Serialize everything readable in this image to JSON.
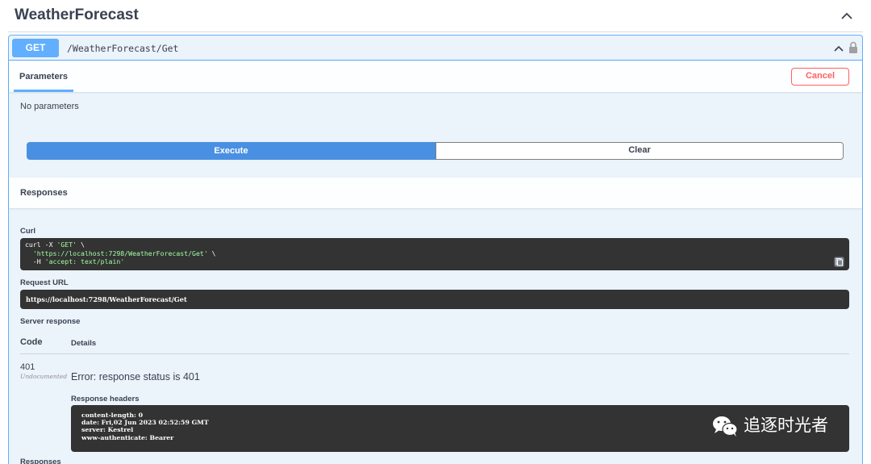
{
  "section": {
    "title": "WeatherForecast"
  },
  "operation": {
    "method": "GET",
    "path": "/WeatherForecast/Get"
  },
  "parameters": {
    "tab_label": "Parameters",
    "cancel_label": "Cancel",
    "empty_text": "No parameters"
  },
  "actions": {
    "execute_label": "Execute",
    "clear_label": "Clear"
  },
  "responses": {
    "title": "Responses",
    "curl_label": "Curl",
    "curl_lines": [
      "curl -X 'GET' \\",
      "  'https://localhost:7298/WeatherForecast/Get' \\",
      "  -H 'accept: text/plain'"
    ],
    "request_url_label": "Request URL",
    "request_url": "https://localhost:7298/WeatherForecast/Get",
    "server_response_label": "Server response",
    "col_code": "Code",
    "col_details": "Details",
    "status_code": "401",
    "undocumented": "Undocumented",
    "error_text": "Error: response status is 401",
    "response_headers_label": "Response headers",
    "headers": [
      "content-length: 0",
      "date: Fri,02 Jun 2023 02:52:59 GMT",
      "server: Kestrel",
      "www-authenticate: Bearer"
    ],
    "watermark_text": "追逐时光者",
    "bottom_label": "Responses"
  },
  "colors": {
    "get_accent": "#61affe",
    "execute_blue": "#4990e2",
    "cancel_red": "#ff6060",
    "code_bg": "#333333",
    "string_green": "#a2fca2"
  },
  "icons": [
    "chevron-up-icon",
    "lock-icon",
    "copy-icon",
    "wechat-icon"
  ]
}
